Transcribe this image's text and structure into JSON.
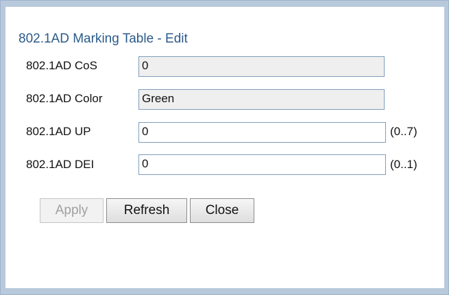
{
  "dialog": {
    "title": "802.1AD Marking Table - Edit"
  },
  "fields": {
    "cos": {
      "label": "802.1AD CoS",
      "value": "0"
    },
    "color": {
      "label": "802.1AD Color",
      "value": "Green"
    },
    "up": {
      "label": "802.1AD UP",
      "value": "0",
      "range": "(0..7)"
    },
    "dei": {
      "label": "802.1AD DEI",
      "value": "0",
      "range": "(0..1)"
    }
  },
  "buttons": {
    "apply": "Apply",
    "refresh": "Refresh",
    "close": "Close"
  }
}
